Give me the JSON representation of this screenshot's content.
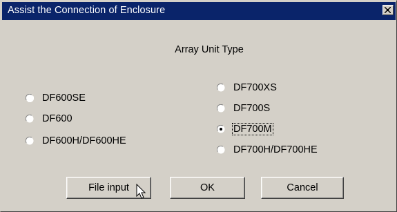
{
  "window": {
    "title": "Assist the Connection of Enclosure",
    "close_icon": "close-x-icon"
  },
  "group": {
    "title": "Array Unit Type"
  },
  "radios": {
    "df600se": {
      "label": "DF600SE",
      "checked": false
    },
    "df600": {
      "label": "DF600",
      "checked": false
    },
    "df600h": {
      "label": "DF600H/DF600HE",
      "checked": false
    },
    "df700xs": {
      "label": "DF700XS",
      "checked": false
    },
    "df700s": {
      "label": "DF700S",
      "checked": false
    },
    "df700m": {
      "label": "DF700M",
      "checked": true
    },
    "df700h": {
      "label": "DF700H/DF700HE",
      "checked": false
    }
  },
  "buttons": {
    "file_input": "File input",
    "ok": "OK",
    "cancel": "Cancel"
  },
  "colors": {
    "titlebar": "#0a246a",
    "face": "#d4d0c8"
  },
  "cursor_icon": "arrow-pointer-icon"
}
